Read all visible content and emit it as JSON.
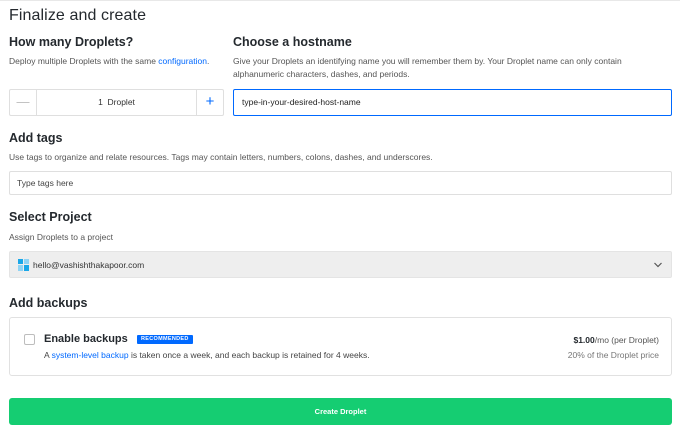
{
  "page": {
    "title": "Finalize and create"
  },
  "droplets": {
    "heading": "How many Droplets?",
    "description_prefix": "Deploy multiple Droplets with the same ",
    "description_link": "configuration",
    "description_suffix": ".",
    "minus_icon": "minus-icon",
    "plus_icon": "plus-icon",
    "minus_glyph": "—",
    "plus_glyph": "+",
    "count_label": "1  Droplet"
  },
  "hostname": {
    "heading": "Choose a hostname",
    "description": "Give your Droplets an identifying name you will remember them by. Your Droplet name can only contain alphanumeric characters, dashes, and periods.",
    "value": "type-in-your-desired-host-name"
  },
  "tags": {
    "heading": "Add tags",
    "description": "Use tags to organize and relate resources. Tags may contain letters, numbers, colons, dashes, and underscores.",
    "placeholder": "Type tags here"
  },
  "project": {
    "heading": "Select Project",
    "description": "Assign Droplets to a project",
    "selected": "hello@vashishthakapoor.com",
    "icon": "project-icon",
    "chevron_icon": "chevron-down-icon"
  },
  "backups": {
    "heading": "Add backups",
    "option_title": "Enable backups",
    "badge": "RECOMMENDED",
    "sub_prefix": "A ",
    "sub_link": "system-level backup",
    "sub_suffix": " is taken once a week, and each backup is retained for 4 weeks.",
    "price_amount": "$1.00",
    "price_unit": "/mo (per Droplet)",
    "price_note": "20% of the Droplet price",
    "checked": false
  },
  "actions": {
    "create_label": "Create Droplet"
  },
  "colors": {
    "accent": "#0069ff",
    "create": "#15cd72",
    "select_bg": "#eeeeee"
  }
}
